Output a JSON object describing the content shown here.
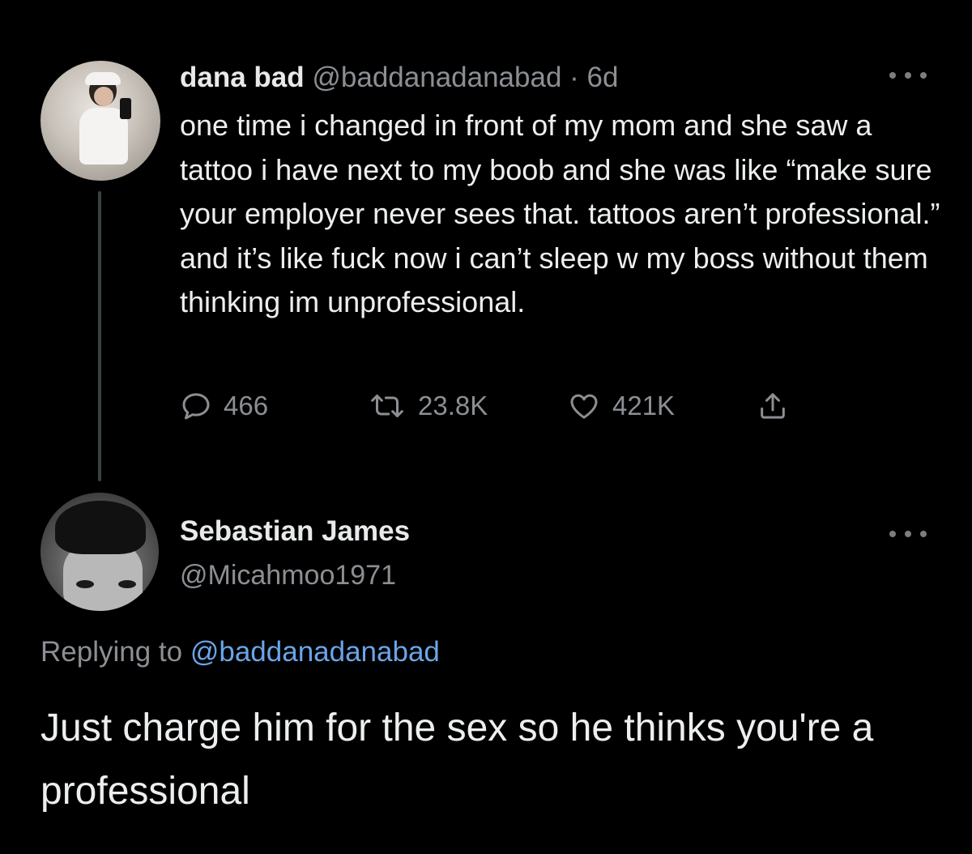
{
  "parent_tweet": {
    "display_name": "dana bad",
    "handle": "@baddanadanabad",
    "separator": "·",
    "time": "6d",
    "text": "one time i changed in front of my mom and she saw a tattoo i have next to my boob and she was like “make sure your employer never sees that. tattoos aren’t professional.” and it’s like fuck now i can’t sleep w my boss without them thinking im unprofessional.",
    "actions": {
      "reply_count": "466",
      "retweet_count": "23.8K",
      "like_count": "421K"
    }
  },
  "reply_tweet": {
    "display_name": "Sebastian James",
    "handle": "@Micahmoo1971",
    "replying_prefix": "Replying to",
    "replying_mention": "@baddanadanabad",
    "text": "Just charge him for the sex so he thinks you're a professional"
  },
  "icons": {
    "reply": "reply-icon",
    "retweet": "retweet-icon",
    "like": "heart-icon",
    "share": "share-icon",
    "more": "more-icon"
  },
  "colors": {
    "background": "#000000",
    "text": "#e7e9ea",
    "secondary": "#8b8f93",
    "link": "#6aa5e8",
    "thread_line": "#3e4144"
  }
}
